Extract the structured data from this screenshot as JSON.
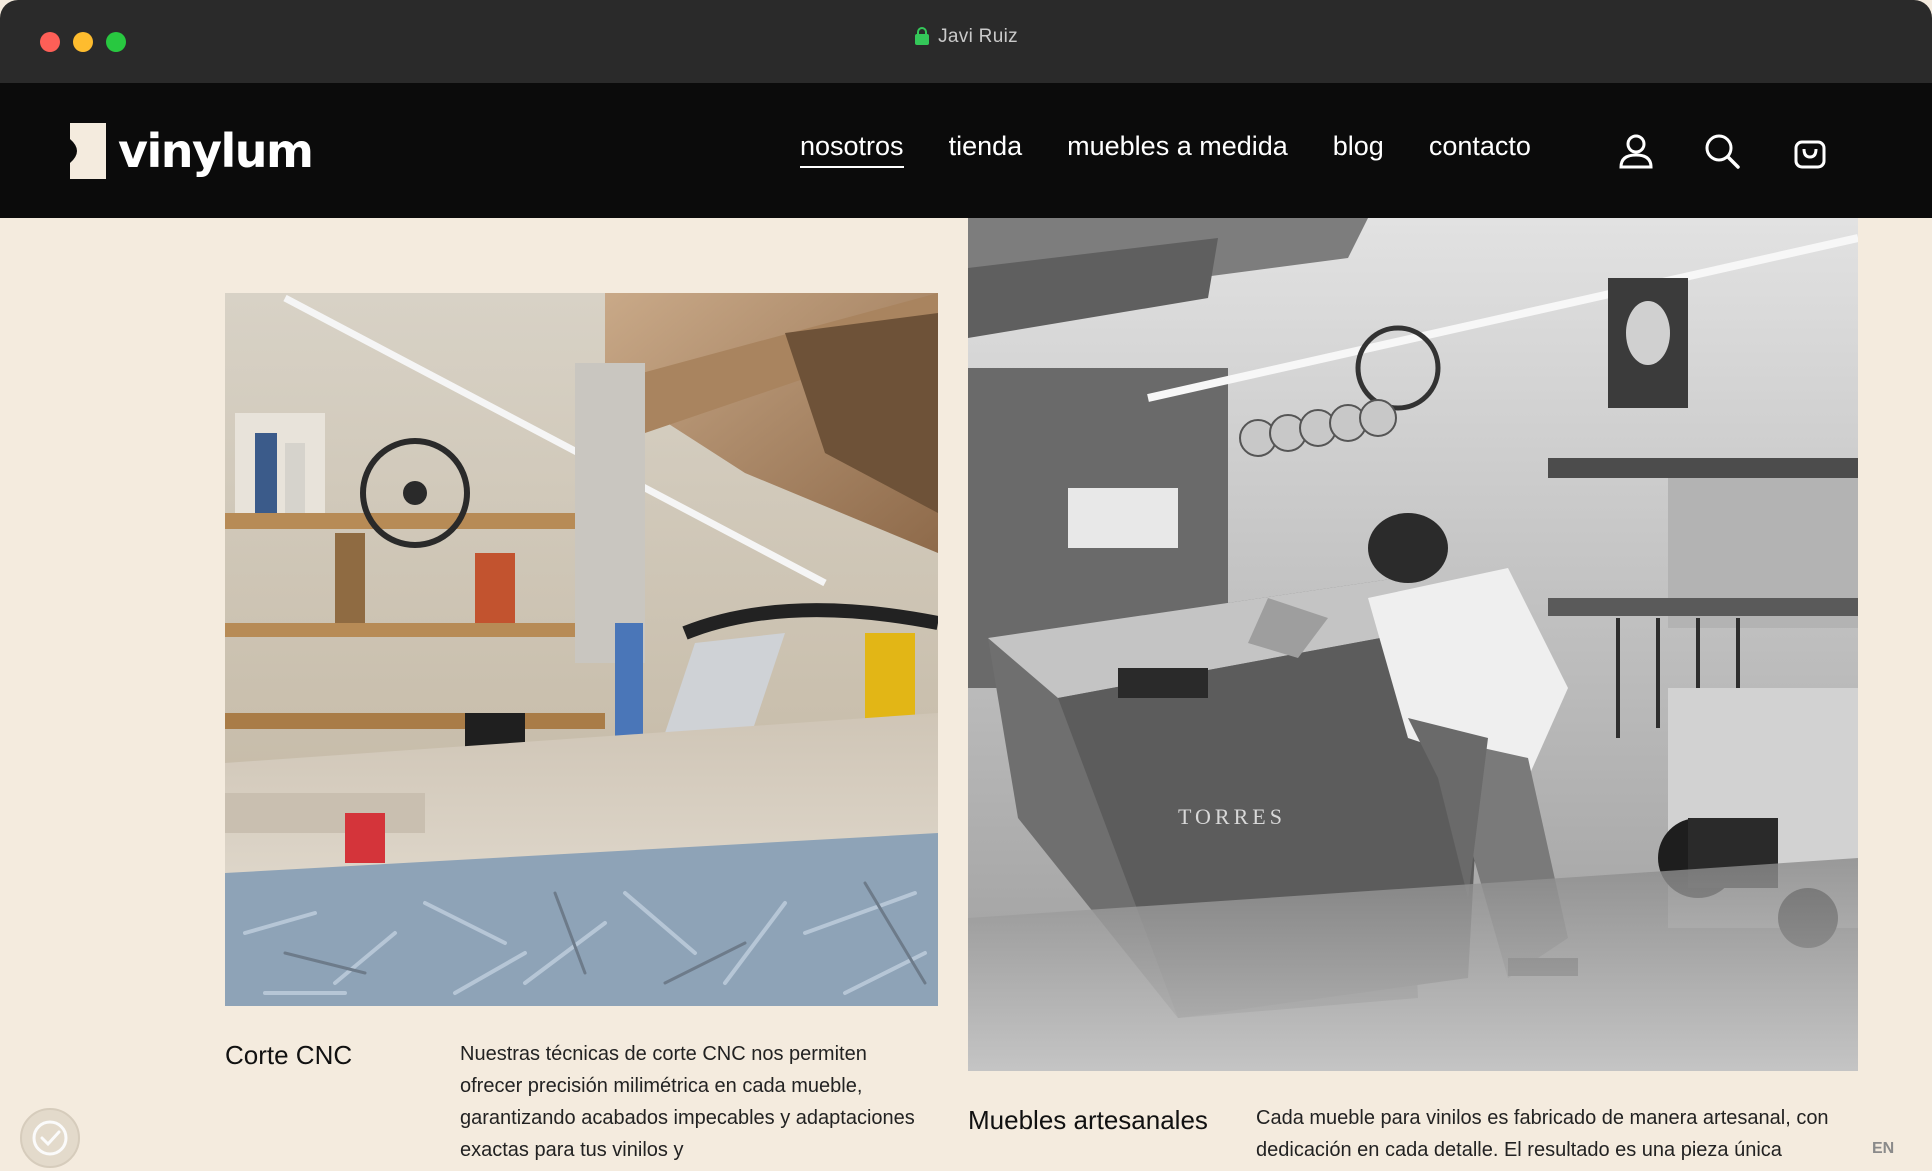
{
  "browser": {
    "address": "Javi Ruiz"
  },
  "nav": {
    "logo_text": "vinylum",
    "items": [
      {
        "label": "nosotros"
      },
      {
        "label": "tienda"
      },
      {
        "label": "muebles a medida"
      },
      {
        "label": "blog"
      },
      {
        "label": "contacto"
      }
    ],
    "icons": [
      "user-icon",
      "search-icon",
      "cart-icon"
    ]
  },
  "sections": {
    "cnc": {
      "title": "Corte CNC",
      "text": "Nuestras técnicas de corte CNC nos permiten ofrecer precisión milimétrica en cada mueble, garantizando acabados impecables y adaptaciones exactas para tus vinilos y"
    },
    "artesanales": {
      "title": "Muebles artesanales",
      "text": "Cada mueble para vinilos es fabricado de manera artesanal, con dedicación en cada detalle. El resultado es una pieza única"
    }
  },
  "workbench_sign": "TORRES",
  "language": "EN",
  "colors": {
    "background": "#f4ebde",
    "navbar": "#0b0b0b",
    "titlebar": "#2a2a2a"
  }
}
